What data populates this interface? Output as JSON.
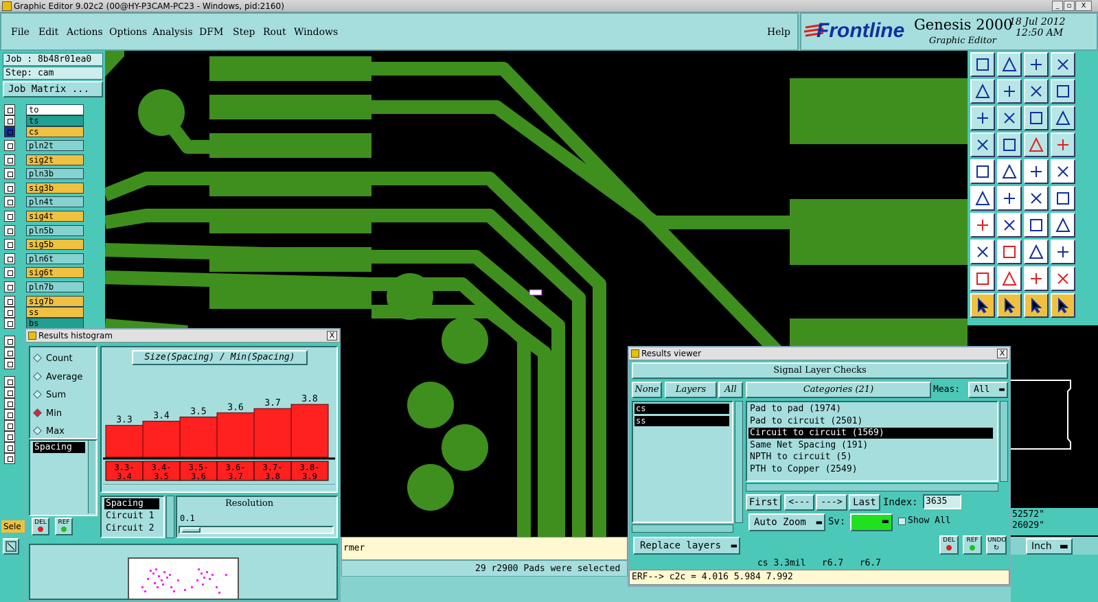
{
  "window": {
    "title": "Graphic Editor 9.02c2 (00@HY-P3CAM-PC23 - Windows, pid:2160)",
    "controls": [
      "_",
      "▫",
      "X"
    ]
  },
  "menu": [
    "File",
    "Edit",
    "Actions",
    "Options",
    "Analysis",
    "DFM",
    "Step",
    "Rout",
    "Windows"
  ],
  "help": "Help",
  "brand": {
    "logo": "Frontline",
    "product": "Genesis 2000",
    "subtitle": "Graphic Editor",
    "date": "18 Jul 2012",
    "time": "12:50 AM"
  },
  "job": {
    "job": "Job : 8b48r01ea0",
    "step": "Step: cam",
    "matrix_button": "Job Matrix ..."
  },
  "layers": [
    {
      "name": "to",
      "color": "#ffffff"
    },
    {
      "name": "ts",
      "color": "#20a090"
    },
    {
      "name": "cs",
      "color": "#f0c040"
    },
    {
      "name": "pln2t",
      "color": "#86d2cf"
    },
    {
      "name": "sig2t",
      "color": "#f0c040"
    },
    {
      "name": "pln3b",
      "color": "#86d2cf"
    },
    {
      "name": "sig3b",
      "color": "#f0c040"
    },
    {
      "name": "pln4t",
      "color": "#86d2cf"
    },
    {
      "name": "sig4t",
      "color": "#f0c040"
    },
    {
      "name": "pln5b",
      "color": "#86d2cf"
    },
    {
      "name": "sig5b",
      "color": "#f0c040"
    },
    {
      "name": "pln6t",
      "color": "#86d2cf"
    },
    {
      "name": "sig6t",
      "color": "#f0c040"
    },
    {
      "name": "pln7b",
      "color": "#86d2cf"
    },
    {
      "name": "sig7b",
      "color": "#f0c040"
    },
    {
      "name": "ss",
      "color": "#f0c040"
    },
    {
      "name": "bs",
      "color": "#20a090"
    }
  ],
  "select_label": "Sele",
  "histogram": {
    "title": "Results histogram",
    "modes": [
      "Count",
      "Average",
      "Sum",
      "Min",
      "Max"
    ],
    "selected_mode": "Min",
    "list_item": "Spacing",
    "chart_title": "Size(Spacing) / Min(Spacing)",
    "bar_color": "#ff2020",
    "chart_data": {
      "type": "bar",
      "categories": [
        "3.3-3.4",
        "3.4-3.5",
        "3.5-3.6",
        "3.6-3.7",
        "3.7-3.8",
        "3.8-3.9"
      ],
      "values": [
        3.3,
        3.4,
        3.5,
        3.6,
        3.7,
        3.8
      ],
      "value_labels": [
        "3.3",
        "3.4",
        "3.5",
        "3.6",
        "3.7",
        "3.8"
      ],
      "category_top": [
        "3.3-",
        "3.4-",
        "3.5-",
        "3.6-",
        "3.7-",
        "3.8-"
      ],
      "category_bottom": [
        "3.4",
        "3.5",
        "3.6",
        "3.7",
        "3.8",
        "3.9"
      ],
      "title": "Size(Spacing) / Min(Spacing)",
      "ylim": [
        0,
        3.9
      ]
    },
    "bottom_list": [
      "Spacing",
      "Circuit 1",
      "Circuit 2"
    ],
    "resolution_label": "Resolution",
    "resolution_value": "0.1",
    "del": "DEL",
    "ref": "REF"
  },
  "results": {
    "title": "Results viewer",
    "header": "Signal Layer Checks",
    "none": "None",
    "layers": "Layers",
    "all": "All",
    "categories": "Categories (21)",
    "meas_label": "Meas:",
    "meas_value": "All",
    "layer_items": [
      "cs",
      "ss"
    ],
    "category_items": [
      "Pad to pad (1974)",
      "Pad to circuit (2501)",
      "Circuit to circuit (1569)",
      "Same Net Spacing (191)",
      "NPTH to circuit (5)",
      "PTH to Copper (2549)"
    ],
    "selected_category": "Circuit to circuit (1569)",
    "first": "First",
    "prev": "<---",
    "next": "--->",
    "last": "Last",
    "index_label": "Index:",
    "index_value": "3635",
    "auto_zoom": "Auto Zoom",
    "sv_label": "Sv:",
    "show_all": "Show All",
    "replace_layers": "Replace layers",
    "del": "DEL",
    "ref": "REF",
    "undo": "UNDO",
    "measure": "cs 3.3mil   r6.7   r6.7",
    "erf": "ERF--> c2c = 4.016 5.984 7.992"
  },
  "status": {
    "selected": "29 r2900 Pads were selected",
    "prompt_fragment": "rmer",
    "coord_x": "52572\"",
    "coord_y": "26029\"",
    "units": "Inch"
  },
  "colors": {
    "copper": "#3f8f1f",
    "canvas": "#000000",
    "panel": "#4cc8b8",
    "menubg": "#a6dede"
  }
}
